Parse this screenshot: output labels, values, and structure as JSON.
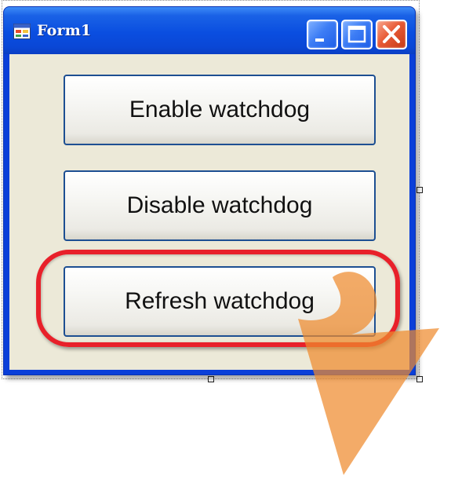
{
  "window": {
    "title": "Form1",
    "caption_buttons": [
      "minimize",
      "maximize",
      "close"
    ]
  },
  "buttons": [
    {
      "label": "Enable watchdog"
    },
    {
      "label": "Disable watchdog"
    },
    {
      "label": "Refresh watchdog",
      "highlighted": true
    }
  ],
  "colors": {
    "titlebar": "#0a4ee0",
    "client_background": "#ece9d8",
    "highlight_ring": "#e8202a",
    "arrow": "#ee8a2e"
  },
  "icons": {
    "app": "form-icon",
    "minimize": "minimize-icon",
    "maximize": "maximize-icon",
    "close": "close-icon",
    "pointer": "curved-arrow-icon"
  }
}
